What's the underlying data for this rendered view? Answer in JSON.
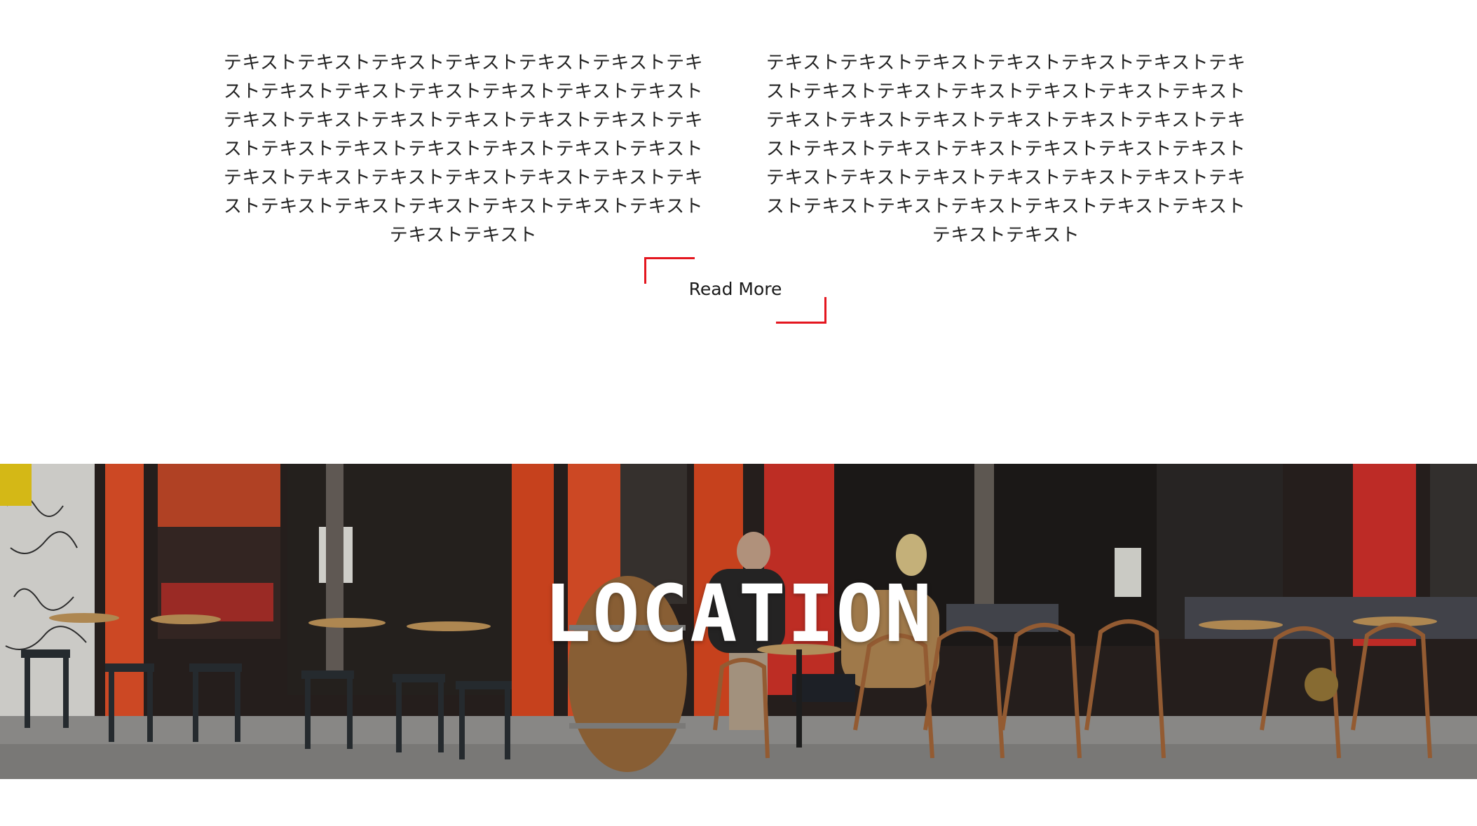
{
  "intro": {
    "left_text": "テキストテキストテキストテキストテキストテキストテキストテキストテキストテキストテキストテキストテキストテキストテキストテキストテキストテキストテキストテキストテキストテキストテキストテキストテキストテキストテキストテキストテキストテキストテキストテキストテキストテキストテキストテキストテキストテキストテキストテキストテキスト",
    "right_text": "テキストテキストテキストテキストテキストテキストテキストテキストテキストテキストテキストテキストテキストテキストテキストテキストテキストテキストテキストテキストテキストテキストテキストテキストテキストテキストテキストテキストテキストテキストテキストテキストテキストテキストテキストテキストテキストテキストテキストテキストテキスト"
  },
  "read_more": {
    "label": "Read More",
    "accent_color": "#e4161f"
  },
  "location": {
    "title": "LOCATION",
    "image_subject": "street cafe terrace photo"
  }
}
